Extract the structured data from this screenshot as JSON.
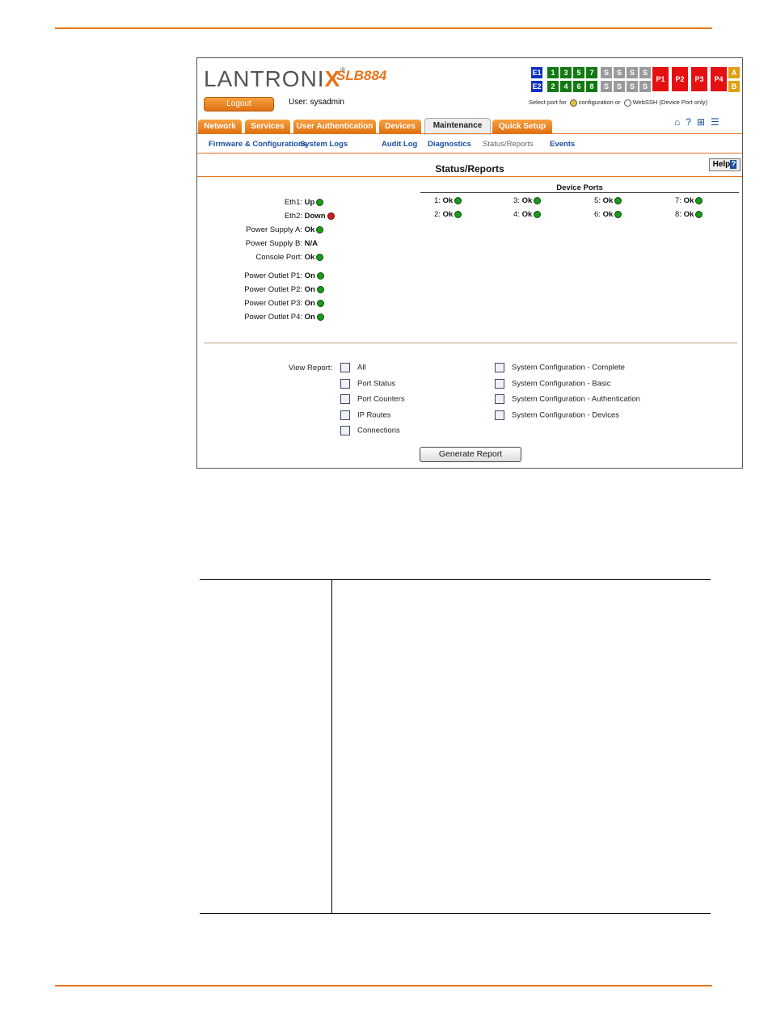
{
  "brand": {
    "logo_main": "LANTRONI",
    "logo_x": "X",
    "logo_mark": "®",
    "model": "SLB884"
  },
  "header": {
    "logout_label": "Logout",
    "user_label": "User: ",
    "user_name": "sysadmin",
    "select_text": "Select port for",
    "config_text": "configuration",
    "or_text": "or",
    "webssh_text": "WebSSH (Device Port only)"
  },
  "port_grid": {
    "eth": [
      "E1",
      "E2"
    ],
    "top_row": [
      "1",
      "3",
      "5",
      "7",
      "S",
      "S",
      "S",
      "S"
    ],
    "bottom_row": [
      "2",
      "4",
      "6",
      "8",
      "S",
      "S",
      "S",
      "S"
    ],
    "power": [
      "P1",
      "P2",
      "P3",
      "P4"
    ],
    "supply": [
      "A",
      "B"
    ]
  },
  "tabs": [
    "Network",
    "Services",
    "User Authentication",
    "Devices",
    "Maintenance",
    "Quick Setup"
  ],
  "active_tab": "Maintenance",
  "top_icons": [
    "home-icon",
    "help-icon",
    "sitemap-icon",
    "notes-icon"
  ],
  "subnav": [
    "Firmware & Configurations",
    "System Logs",
    "Audit Log",
    "Diagnostics",
    "Status/Reports",
    "Events"
  ],
  "current_subnav": "Status/Reports",
  "page_title": "Status/Reports",
  "help_label": "Help",
  "help_q": "?",
  "status": [
    {
      "label": "Eth1:",
      "value": "Up",
      "state": "ok"
    },
    {
      "label": "Eth2:",
      "value": "Down",
      "state": "bad"
    },
    {
      "label": "Power Supply A:",
      "value": "Ok",
      "state": "ok"
    },
    {
      "label": "Power Supply B:",
      "value": "N/A",
      "state": "none"
    },
    {
      "label": "Console Port:",
      "value": "Ok",
      "state": "ok"
    },
    {
      "label": "Power Outlet P1:",
      "value": "On",
      "state": "ok"
    },
    {
      "label": "Power Outlet P2:",
      "value": "On",
      "state": "ok"
    },
    {
      "label": "Power Outlet P3:",
      "value": "On",
      "state": "ok"
    },
    {
      "label": "Power Outlet P4:",
      "value": "On",
      "state": "ok"
    }
  ],
  "device_ports": {
    "heading": "Device Ports",
    "ports": [
      {
        "num": "1:",
        "value": "Ok"
      },
      {
        "num": "3:",
        "value": "Ok"
      },
      {
        "num": "5:",
        "value": "Ok"
      },
      {
        "num": "7:",
        "value": "Ok"
      },
      {
        "num": "2:",
        "value": "Ok"
      },
      {
        "num": "4:",
        "value": "Ok"
      },
      {
        "num": "6:",
        "value": "Ok"
      },
      {
        "num": "8:",
        "value": "Ok"
      }
    ]
  },
  "reports": {
    "view_label": "View Report:",
    "left": [
      "All",
      "Port Status",
      "Port Counters",
      "IP Routes",
      "Connections"
    ],
    "right": [
      "System Configuration - Complete",
      "System Configuration - Basic",
      "System Configuration - Authentication",
      "System Configuration - Devices"
    ],
    "generate_label": "Generate Report"
  },
  "colors": {
    "accent": "#e8741a",
    "link": "#1a4fa0",
    "ok": "#1c9a1c",
    "bad": "#d02020"
  }
}
